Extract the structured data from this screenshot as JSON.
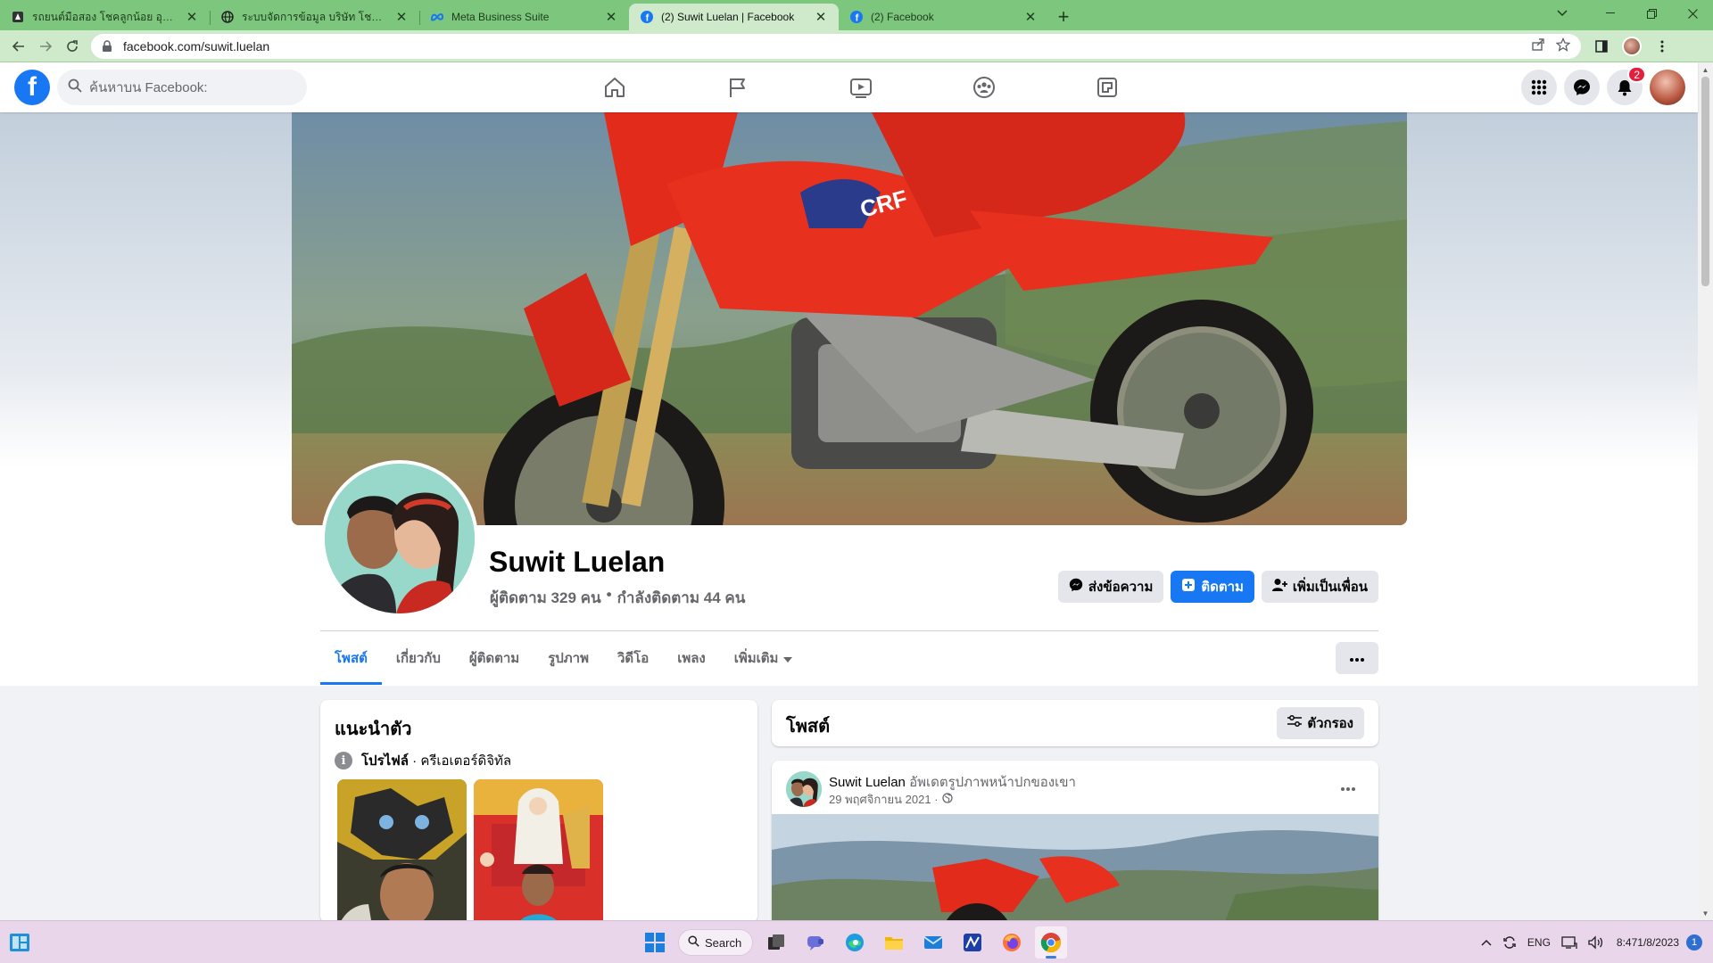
{
  "browser": {
    "tabs": [
      {
        "title": "รถยนต์มือสอง โชคลูกน้อย อุดรธานี",
        "favicon": "custom-favicon",
        "active": false
      },
      {
        "title": "ระบบจัดการข้อมูล บริษัท โชคลูกน้อย จำกัด",
        "favicon": "globe-icon",
        "active": false
      },
      {
        "title": "Meta Business Suite",
        "favicon": "meta-icon",
        "active": false
      },
      {
        "title": "(2) Suwit Luelan | Facebook",
        "favicon": "facebook-icon",
        "active": true
      },
      {
        "title": "(2) Facebook",
        "favicon": "facebook-icon",
        "active": false
      }
    ],
    "url": "facebook.com/suwit.luelan",
    "tab_bar_color": "#7dc67d",
    "toolbar_color": "#cfeacb"
  },
  "facebook": {
    "logo_letter": "f",
    "search_placeholder": "ค้นหาบน Facebook:",
    "notifications_count": "2",
    "brand_color": "#1877f2"
  },
  "profile": {
    "name": "Suwit Luelan",
    "followers": "ผู้ติดตาม 329 คน",
    "separator": "•",
    "following": "กำลังติดตาม 44 คน",
    "buttons": {
      "message": "ส่งข้อความ",
      "follow": "ติดตาม",
      "add_friend": "เพิ่มเป็นเพื่อน"
    },
    "tabs": [
      {
        "label": "โพสต์",
        "active": true
      },
      {
        "label": "เกี่ยวกับ",
        "active": false
      },
      {
        "label": "ผู้ติดตาม",
        "active": false
      },
      {
        "label": "รูปภาพ",
        "active": false
      },
      {
        "label": "วิดีโอ",
        "active": false
      },
      {
        "label": "เพลง",
        "active": false
      },
      {
        "label": "เพิ่มเติม",
        "active": false,
        "dropdown": true
      }
    ]
  },
  "intro": {
    "title": "แนะนำตัว",
    "profile_label": "โปรไฟล์",
    "profile_category": " · ครีเอเตอร์ดิจิทัล"
  },
  "posts": {
    "title": "โพสต์",
    "filter_label": "ตัวกรอง",
    "first_post": {
      "author": "Suwit Luelan",
      "action": " อัพเดตรูปภาพหน้าปกของเขา",
      "date": "29 พฤศจิกายน 2021 ·"
    }
  },
  "taskbar": {
    "search_label": "Search",
    "language": "ENG",
    "time": "8:47",
    "date": "1/8/2023",
    "notification_count": "1"
  }
}
